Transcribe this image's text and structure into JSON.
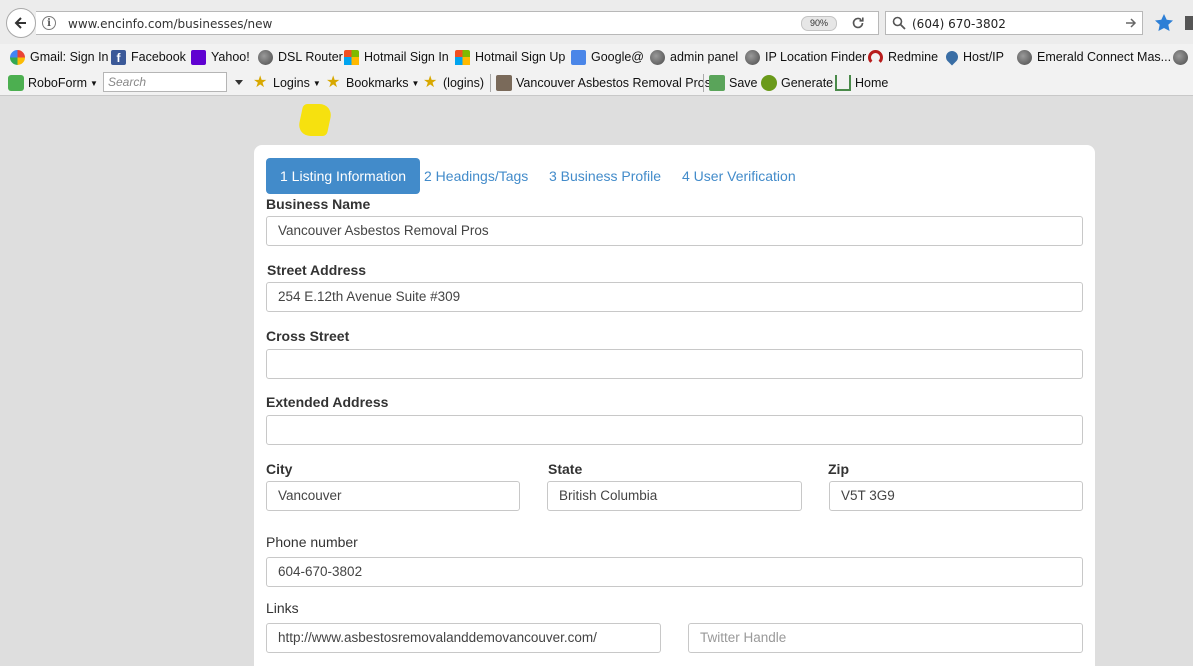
{
  "browser": {
    "url": "www.encinfo.com/businesses/new",
    "zoom": "90%",
    "search_value": "(604) 670-3802"
  },
  "bookmarks": [
    {
      "label": "Gmail: Sign In",
      "icon": "google-icon"
    },
    {
      "label": "Facebook",
      "icon": "facebook-icon"
    },
    {
      "label": "Yahoo!",
      "icon": "yahoo-icon"
    },
    {
      "label": "DSL Router",
      "icon": "globe-icon"
    },
    {
      "label": "Hotmail Sign In",
      "icon": "windows-icon"
    },
    {
      "label": "Hotmail Sign Up",
      "icon": "windows-icon"
    },
    {
      "label": "Google@",
      "icon": "google-translate-icon"
    },
    {
      "label": "admin panel",
      "icon": "globe-icon"
    },
    {
      "label": "IP Location Finder",
      "icon": "globe-icon"
    },
    {
      "label": "Redmine",
      "icon": "redmine-icon"
    },
    {
      "label": "Host/IP",
      "icon": "map-pin-icon"
    },
    {
      "label": "Emerald Connect Mas...",
      "icon": "globe-icon"
    }
  ],
  "toolbar": {
    "roboform": "RoboForm",
    "search_placeholder": "Search",
    "logins": "Logins",
    "bookmarks": "Bookmarks",
    "logins_paren": "(logins)",
    "site": "Vancouver Asbestos Removal Pros",
    "save": "Save",
    "generate": "Generate",
    "home": "Home"
  },
  "tabs": [
    {
      "label": "1 Listing Information",
      "active": true
    },
    {
      "label": "2 Headings/Tags",
      "active": false
    },
    {
      "label": "3 Business Profile",
      "active": false
    },
    {
      "label": "4 User Verification",
      "active": false
    }
  ],
  "form": {
    "business_name": {
      "label": "Business Name",
      "value": "Vancouver Asbestos Removal Pros"
    },
    "street_address": {
      "label": "Street Address",
      "value": "254 E.12th Avenue Suite #309"
    },
    "cross_street": {
      "label": "Cross Street",
      "value": ""
    },
    "extended_address": {
      "label": "Extended Address",
      "value": ""
    },
    "city": {
      "label": "City",
      "value": "Vancouver"
    },
    "state": {
      "label": "State",
      "value": "British Columbia"
    },
    "zip": {
      "label": "Zip",
      "value": "V5T 3G9"
    },
    "phone": {
      "label": "Phone number",
      "value": "604-670-3802"
    },
    "links": {
      "label": "Links",
      "website": "http://www.asbestosremovalanddemovancouver.com/",
      "twitter_placeholder": "Twitter Handle"
    }
  },
  "colors": {
    "accent": "#428bca",
    "page_bg": "#dedede"
  }
}
